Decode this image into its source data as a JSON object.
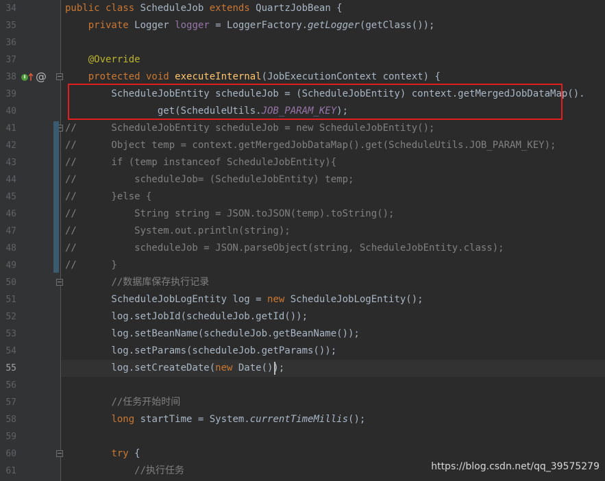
{
  "editor": {
    "current_line": 55,
    "colors": {
      "background": "#2b2b2b",
      "keyword": "#cc7832",
      "annotation": "#bbb529",
      "field": "#9876aa",
      "method_decl": "#ffc66d",
      "comment": "#808080",
      "default_text": "#a9b7c6",
      "highlight_box": "#e01e1e"
    },
    "lines": [
      {
        "n": "34",
        "segs": [
          [
            "kw",
            "public class "
          ],
          [
            "",
            "ScheduleJob "
          ],
          [
            "kw",
            "extends "
          ],
          [
            "",
            "QuartzJobBean {"
          ]
        ]
      },
      {
        "n": "35",
        "segs": [
          [
            "",
            "    "
          ],
          [
            "kw",
            "private "
          ],
          [
            "",
            "Logger "
          ],
          [
            "fld",
            "logger "
          ],
          [
            "",
            "= LoggerFactory."
          ],
          [
            "it",
            "getLogger"
          ],
          [
            "",
            "(getClass());"
          ]
        ]
      },
      {
        "n": "36",
        "segs": []
      },
      {
        "n": "37",
        "segs": [
          [
            "",
            "    "
          ],
          [
            "ann",
            "@Override"
          ]
        ]
      },
      {
        "n": "38",
        "segs": [
          [
            "",
            "    "
          ],
          [
            "kw",
            "protected void "
          ],
          [
            "method",
            "executeInternal"
          ],
          [
            "",
            "(JobExecutionContext context) {"
          ]
        ]
      },
      {
        "n": "39",
        "segs": [
          [
            "",
            "        ScheduleJobEntity scheduleJob = (ScheduleJobEntity) context.getMergedJobDataMap()."
          ]
        ]
      },
      {
        "n": "40",
        "segs": [
          [
            "",
            "                get(ScheduleUtils."
          ],
          [
            "fldit",
            "JOB_PARAM_KEY"
          ],
          [
            "",
            "); "
          ]
        ]
      },
      {
        "n": "41",
        "segs": [
          [
            "cmt",
            "//      ScheduleJobEntity scheduleJob = new ScheduleJobEntity();"
          ]
        ]
      },
      {
        "n": "42",
        "segs": [
          [
            "cmt",
            "//      Object temp = context.getMergedJobDataMap().get(ScheduleUtils.JOB_PARAM_KEY);"
          ]
        ]
      },
      {
        "n": "43",
        "segs": [
          [
            "cmt",
            "//      if (temp instanceof ScheduleJobEntity){"
          ]
        ]
      },
      {
        "n": "44",
        "segs": [
          [
            "cmt",
            "//          scheduleJob= (ScheduleJobEntity) temp;"
          ]
        ]
      },
      {
        "n": "45",
        "segs": [
          [
            "cmt",
            "//      }else {"
          ]
        ]
      },
      {
        "n": "46",
        "segs": [
          [
            "cmt",
            "//          String string = JSON.toJSON(temp).toString();"
          ]
        ]
      },
      {
        "n": "47",
        "segs": [
          [
            "cmt",
            "//          System.out.println(string);"
          ]
        ]
      },
      {
        "n": "48",
        "segs": [
          [
            "cmt",
            "//          scheduleJob = JSON.parseObject(string, ScheduleJobEntity.class);"
          ]
        ]
      },
      {
        "n": "49",
        "segs": [
          [
            "cmt",
            "//      }"
          ]
        ]
      },
      {
        "n": "50",
        "segs": [
          [
            "",
            "        "
          ],
          [
            "cmt",
            "//数据库保存执行记录"
          ]
        ]
      },
      {
        "n": "51",
        "segs": [
          [
            "",
            "        ScheduleJobLogEntity log = "
          ],
          [
            "kw",
            "new "
          ],
          [
            "",
            "ScheduleJobLogEntity();"
          ]
        ]
      },
      {
        "n": "52",
        "segs": [
          [
            "",
            "        log.setJobId(scheduleJob.getId());"
          ]
        ]
      },
      {
        "n": "53",
        "segs": [
          [
            "",
            "        log.setBeanName(scheduleJob.getBeanName());"
          ]
        ]
      },
      {
        "n": "54",
        "segs": [
          [
            "",
            "        log.setParams(scheduleJob.getParams());"
          ]
        ]
      },
      {
        "n": "55",
        "segs": [
          [
            "",
            "        log.setCreateDate("
          ],
          [
            "kw",
            "new "
          ],
          [
            "",
            "Date());"
          ]
        ]
      },
      {
        "n": "56",
        "segs": []
      },
      {
        "n": "57",
        "segs": [
          [
            "",
            "        "
          ],
          [
            "cmt",
            "//任务开始时间"
          ]
        ]
      },
      {
        "n": "58",
        "segs": [
          [
            "",
            "        "
          ],
          [
            "kw",
            "long "
          ],
          [
            "",
            "startTime = System."
          ],
          [
            "it",
            "currentTimeMillis"
          ],
          [
            "",
            "();"
          ]
        ]
      },
      {
        "n": "59",
        "segs": []
      },
      {
        "n": "60",
        "segs": [
          [
            "",
            "        "
          ],
          [
            "kw",
            "try "
          ],
          [
            "",
            "{"
          ]
        ]
      },
      {
        "n": "61",
        "segs": [
          [
            "",
            "            "
          ],
          [
            "cmt",
            "//执行任务"
          ]
        ]
      }
    ],
    "gutter_icons": {
      "override_marker": "override-up-arrow-icon",
      "annotation_marker": "at-sign-icon"
    }
  },
  "watermark": "https://blog.csdn.net/qq_39575279"
}
